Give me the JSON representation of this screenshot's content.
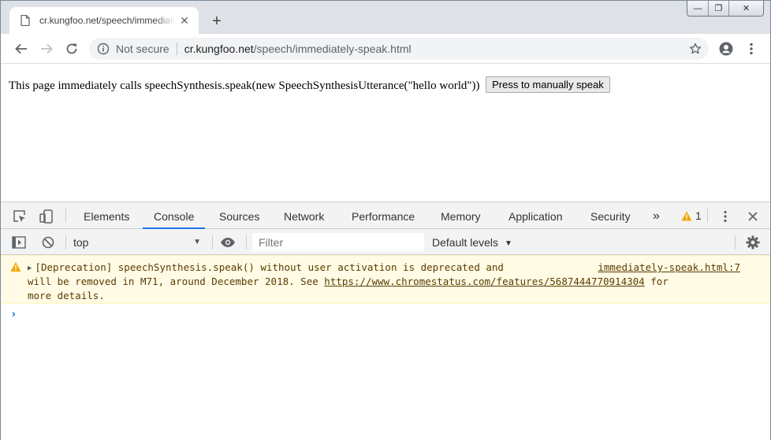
{
  "tab": {
    "title": "cr.kungfoo.net/speech/immediately-speak.html",
    "close_glyph": "✕",
    "newtab_glyph": "+"
  },
  "window_controls": {
    "minimize": "—",
    "restore": "❐",
    "close": "✕"
  },
  "omnibox": {
    "security_label": "Not secure",
    "url_host": "cr.kungfoo.net",
    "url_path": "/speech/immediately-speak.html"
  },
  "page": {
    "text": "This page immediately calls speechSynthesis.speak(new SpeechSynthesisUtterance(\"hello world\"))",
    "button_label": "Press to manually speak"
  },
  "devtools": {
    "tabs": [
      {
        "label": "Elements"
      },
      {
        "label": "Console"
      },
      {
        "label": "Sources"
      },
      {
        "label": "Network"
      },
      {
        "label": "Performance"
      },
      {
        "label": "Memory"
      },
      {
        "label": "Application"
      },
      {
        "label": "Security"
      }
    ],
    "more_tabs_glyph": "»",
    "warning_count": "1",
    "context": "top",
    "filter_placeholder": "Filter",
    "levels_label": "Default levels",
    "levels_arrow": "▼",
    "context_arrow": "▼",
    "message": {
      "line1": "[Deprecation] speechSynthesis.speak() without user activation is deprecated and",
      "line2_prefix": "will be removed in M71, around December 2018. See ",
      "line2_link": "https://www.chromestatus.com/features/5687444770914304",
      "line2_suffix": " for",
      "line3": "more details.",
      "source": "immediately-speak.html:7"
    },
    "prompt_glyph": "›"
  },
  "colors": {
    "accent": "#1a73e8",
    "warning_bg": "#fffbe5",
    "warning_text": "#5c3c00",
    "warning_icon": "#f2a600"
  }
}
